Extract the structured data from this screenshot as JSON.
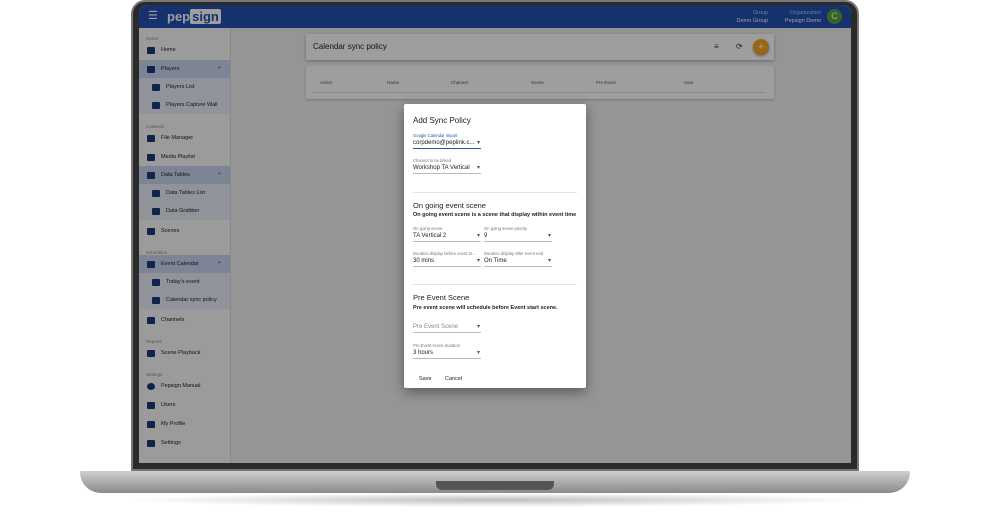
{
  "header": {
    "logo_left": "pep",
    "logo_right": "sign",
    "group_label": "Group",
    "group_value": "Demo Group",
    "org_label": "Organization",
    "org_value": "Pepsign Demo",
    "avatar_letter": "C"
  },
  "sidebar": {
    "sections": {
      "home": "Home",
      "contents": "Contents",
      "schedules": "Schedules",
      "reports": "Reports",
      "settings": "Settings"
    },
    "items": {
      "home": "Home",
      "players": "Players",
      "players_list": "Players List",
      "players_capture_wall": "Players Capture Wall",
      "file_manager": "File Manager",
      "media_playlist": "Media Playlist",
      "data_tables": "Data Tables",
      "data_tables_list": "Data Tables List",
      "data_grabber": "Data Grabber",
      "scenes": "Scenes",
      "event_calendar": "Event Calendar",
      "todays_event": "Today's event",
      "calendar_sync_policy": "Calendar sync policy",
      "channels": "Channels",
      "scene_playback": "Scene Playback",
      "pepsign_manual": "Pepsign Manual",
      "users": "Users",
      "my_profile": "My Profile",
      "settings": "Settings"
    }
  },
  "page": {
    "title": "Calendar sync policy",
    "add_icon": "+",
    "columns": [
      "Action",
      "Name",
      "Channel",
      "Scene",
      "Pre Event",
      "User"
    ]
  },
  "dialog": {
    "title": "Add Sync Policy",
    "google_calendar": {
      "label": "Google Calendar import",
      "value": "corpdemo@peplink.c..."
    },
    "channel": {
      "label": "Channel to be linked",
      "value": "Workshop TA Vertical"
    },
    "ongoing_heading": "On going event scene",
    "ongoing_desc": "On going event scene is a scene that display within event time",
    "ongoing_scene": {
      "label": "On going scene",
      "value": "TA Vertical 2"
    },
    "ongoing_priority": {
      "label": "On going scene priority",
      "value": "9"
    },
    "duration_before": {
      "label": "Duration display before event st...",
      "value": "30 mins"
    },
    "duration_after": {
      "label": "Duration display after event end",
      "value": "On Time"
    },
    "pre_heading": "Pre Event Scene",
    "pre_desc": "Pre event scene will schedule before Event start scene.",
    "pre_scene": {
      "placeholder": "Pre Event Scene"
    },
    "pre_duration": {
      "label": "Pre Event scene duration",
      "value": "3 hours"
    },
    "save": "Save",
    "cancel": "Cancel"
  }
}
